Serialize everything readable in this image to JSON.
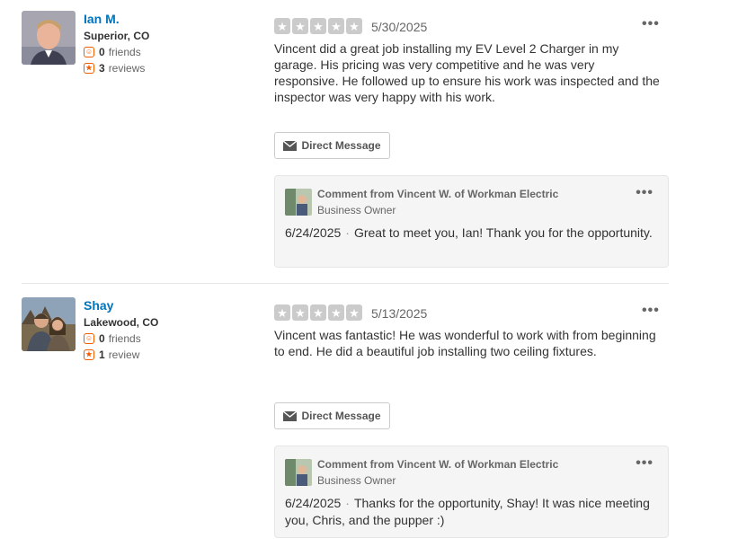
{
  "reviews": [
    {
      "user": {
        "name": "Ian M.",
        "location": "Superior, CO",
        "friends_count": "0",
        "friends_label": "friends",
        "reviews_count": "3",
        "reviews_label": "reviews"
      },
      "rating": 5,
      "date": "5/30/2025",
      "text": "Vincent did a great job installing my EV Level 2 Charger in my garage.  His pricing was very competitive and he was very responsive.  He followed up to ensure his work was inspected and the inspector was very happy with his work.",
      "direct_message_label": "Direct Message",
      "comment": {
        "title": "Comment from Vincent W. of Workman Electric",
        "role": "Business Owner",
        "date": "6/24/2025",
        "separator": "·",
        "text": "Great to meet you, Ian! Thank you for the opportunity."
      }
    },
    {
      "user": {
        "name": "Shay",
        "location": "Lakewood, CO",
        "friends_count": "0",
        "friends_label": "friends",
        "reviews_count": "1",
        "reviews_label": "review"
      },
      "rating": 5,
      "date": "5/13/2025",
      "text": "Vincent was fantastic! He was wonderful to work with from beginning to end. He did a beautiful job installing two ceiling fixtures.",
      "direct_message_label": "Direct Message",
      "comment": {
        "title": "Comment from Vincent W. of Workman Electric",
        "role": "Business Owner",
        "date": "6/24/2025",
        "separator": "·",
        "text": "Thanks for the opportunity, Shay! It was nice meeting you, Chris, and the pupper :)"
      }
    }
  ],
  "icons": {
    "more": "more-options-icon",
    "envelope": "envelope-icon",
    "friends": "friends-icon",
    "reviews": "reviews-star-icon",
    "star": "star-icon"
  },
  "colors": {
    "username": "#0073bb",
    "stat_icon": "#f15c00",
    "star_bg": "#cbcbcb",
    "comment_bg": "#f5f5f5"
  }
}
